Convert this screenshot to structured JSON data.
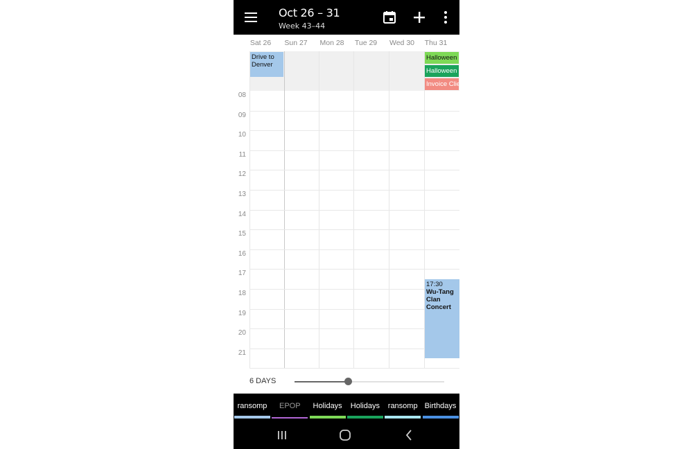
{
  "appbar": {
    "title": "Oct 26 – 31",
    "subtitle": "Week 43–44",
    "icons": [
      "menu-icon",
      "calendar-today-icon",
      "add-icon",
      "more-vert-icon"
    ]
  },
  "days": [
    {
      "label": "Sat 26"
    },
    {
      "label": "Sun 27"
    },
    {
      "label": "Mon 28"
    },
    {
      "label": "Tue 29"
    },
    {
      "label": "Wed 30"
    },
    {
      "label": "Thu 31"
    }
  ],
  "hours": [
    "08",
    "09",
    "10",
    "11",
    "12",
    "13",
    "14",
    "15",
    "16",
    "17",
    "18",
    "19",
    "20",
    "21"
  ],
  "allday_events": [
    {
      "title": "Drive to Denver",
      "day": 0,
      "color": "#a4c8ea",
      "text_color": "#111111"
    },
    {
      "title": "Halloween",
      "day": 5,
      "color": "#7ed957",
      "text_color": "#111111"
    },
    {
      "title": "Halloween",
      "day": 5,
      "color": "#1aa35c",
      "text_color": "#ffffff"
    },
    {
      "title": "Invoice Client",
      "day": 5,
      "color": "#f28b82",
      "text_color": "#ffffff"
    }
  ],
  "timed_events": [
    {
      "time": "17:30",
      "title": "Wu-Tang Clan Concert",
      "day": 5,
      "start": 17.5,
      "end": 21.5,
      "color": "#a4c8ea",
      "text_color": "#111111"
    }
  ],
  "slider": {
    "label": "6 DAYS",
    "fraction": 0.36
  },
  "calendars": [
    {
      "name": "ransomp",
      "color": "#a4c8ea",
      "enabled": true
    },
    {
      "name": "EPOP",
      "color": "#b266d6",
      "enabled": false
    },
    {
      "name": "Holidays",
      "color": "#7ed957",
      "enabled": true
    },
    {
      "name": "Holidays",
      "color": "#1aa35c",
      "enabled": true
    },
    {
      "name": "ransomp",
      "color": "#a8e6f0",
      "enabled": true
    },
    {
      "name": "Birthdays",
      "color": "#4a90e2",
      "enabled": true
    }
  ],
  "navbar": {
    "icons": [
      "recent-apps-icon",
      "home-icon",
      "back-icon"
    ]
  }
}
